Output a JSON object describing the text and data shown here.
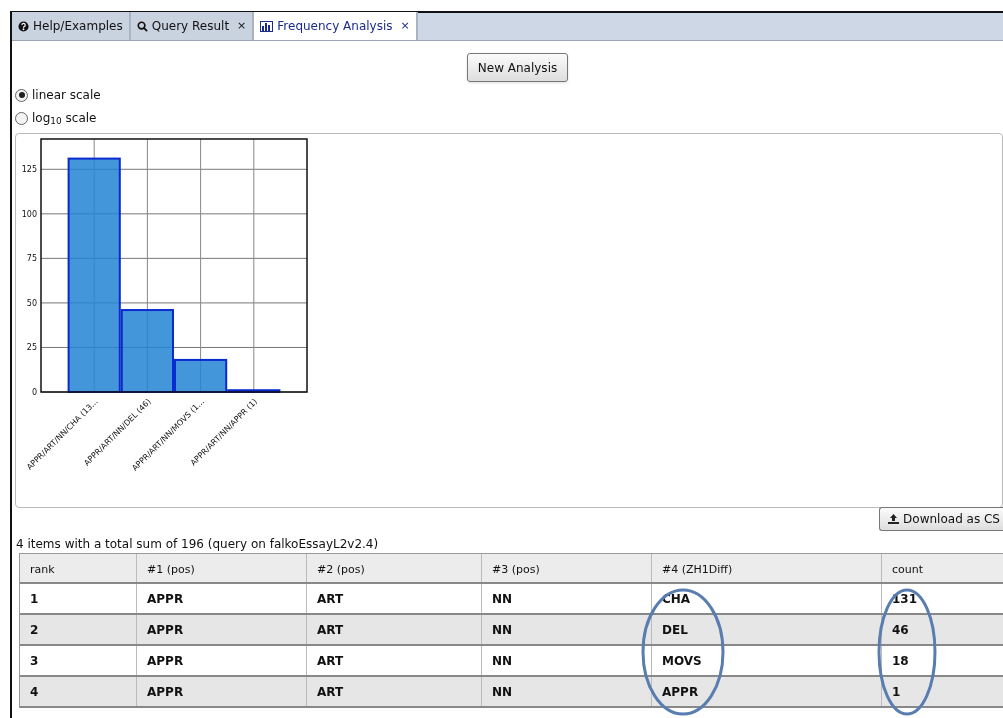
{
  "tabs": [
    {
      "label": "Help/Examples",
      "kind": "help",
      "closable": false,
      "selected": false
    },
    {
      "label": "Query Result",
      "kind": "search",
      "closable": true,
      "selected": false
    },
    {
      "label": "Frequency Analysis",
      "kind": "chart",
      "closable": true,
      "selected": true
    }
  ],
  "close_glyph": "×",
  "new_analysis_button": "New Analysis",
  "scale_options": [
    {
      "label": "linear scale",
      "selected": true
    },
    {
      "label": "log$_{10}$ scale",
      "selected": false
    }
  ],
  "chart": {
    "chart_data": {
      "type": "bar",
      "categories": [
        "APPR/ART/NN/CHA (13...",
        "APPR/ART/NN/DEL (46)",
        "APPR/ART/NN/MOVS (1...",
        "APPR/ART/NN/APPR (1)"
      ],
      "values": [
        131,
        46,
        18,
        1
      ],
      "ylim": [
        0,
        142
      ],
      "grid": true,
      "yticks": [
        0,
        25,
        50,
        75,
        100,
        125
      ],
      "color": "#2284d4"
    }
  },
  "download_button": "Download as CS",
  "summary": "4 items with a total sum of 196 (query on falkoEssayL2v2.4)",
  "table": {
    "columns": [
      "rank",
      "#1 (pos)",
      "#2 (pos)",
      "#3 (pos)",
      "#4 (ZH1Diff)",
      "count"
    ],
    "rows": [
      [
        "1",
        "APPR",
        "ART",
        "NN",
        "CHA",
        "131"
      ],
      [
        "2",
        "APPR",
        "ART",
        "NN",
        "DEL",
        "46"
      ],
      [
        "3",
        "APPR",
        "ART",
        "NN",
        "MOVS",
        "18"
      ],
      [
        "4",
        "APPR",
        "ART",
        "NN",
        "APPR",
        "1"
      ]
    ]
  },
  "annotations": [
    {
      "kind": "ellipse"
    },
    {
      "kind": "ellipse"
    }
  ]
}
